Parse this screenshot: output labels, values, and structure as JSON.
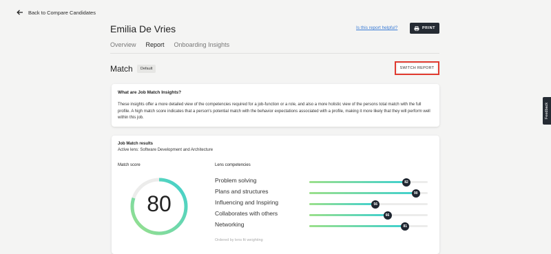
{
  "nav": {
    "back_label": "Back to Compare Candidates"
  },
  "candidate": {
    "name": "Emilia De Vries"
  },
  "header": {
    "helpful_link": "Is this report helpful?",
    "print_label": "PRINT"
  },
  "tabs": [
    {
      "label": "Overview",
      "active": false
    },
    {
      "label": "Report",
      "active": true
    },
    {
      "label": "Onboarding Insights",
      "active": false
    }
  ],
  "match": {
    "title": "Match",
    "badge": "Default",
    "switch_label": "SWITCH REPORT"
  },
  "insights": {
    "title": "What are Job Match Insights?",
    "body": "These insights offer a more detailed view of the competencies required for a job-function or a role, and also a more holistic view of the persons total match with the full profile. A high match score indicates that a person's potential match with the behavior expectations associated with a profile, making it more likely that they will perform well within this job."
  },
  "job_match": {
    "title": "Job Match results",
    "lens": "Active lens: Software Development and Architecture",
    "score_label": "Match score",
    "score": 80,
    "competencies_label": "Lens competencies",
    "competencies": [
      {
        "name": "Problem solving",
        "value": 82
      },
      {
        "name": "Plans and structures",
        "value": 90
      },
      {
        "name": "Influencing and Inspiring",
        "value": 56
      },
      {
        "name": "Collaborates with others",
        "value": 66
      },
      {
        "name": "Networking",
        "value": 81
      }
    ],
    "ordered_note": "Ordered by lens fit weighting"
  },
  "feedback_tab": "Feedback",
  "colors": {
    "accent_start": "#9be08a",
    "accent_end": "#3fd0cf",
    "dark": "#252b33",
    "highlight": "#e03a2f"
  },
  "icons": {
    "back": "arrow-left-icon",
    "print": "printer-icon"
  }
}
